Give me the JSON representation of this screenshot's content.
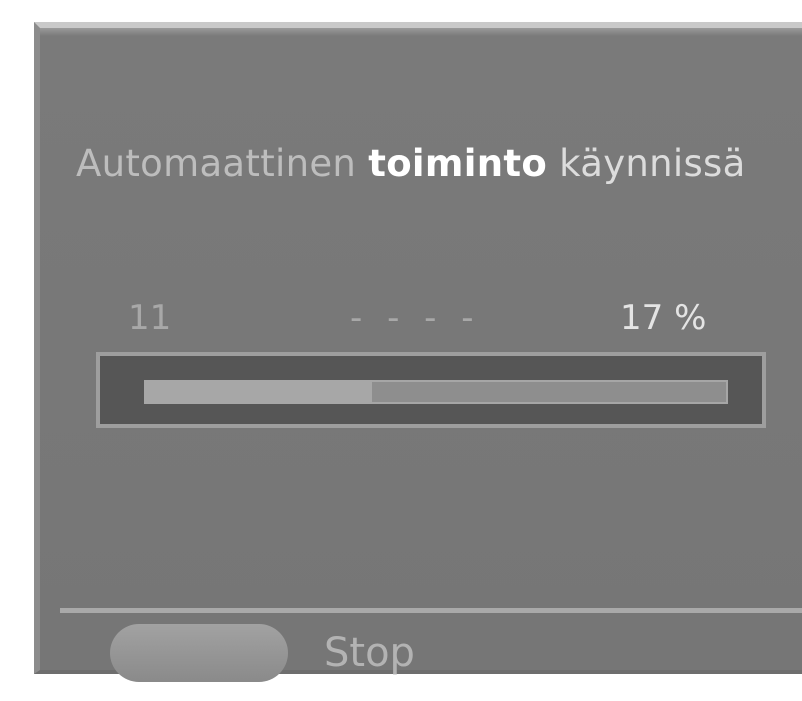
{
  "dialog": {
    "title_part1": "Automaattinen ",
    "title_part2": "toiminto",
    "title_part3": " käynnissä"
  },
  "progress": {
    "channel": "11",
    "station": "- - - -",
    "percent_label": "17 %",
    "percent": 17
  },
  "footer": {
    "stop_label": "Stop",
    "stop_button_color": "#999999"
  },
  "colors": {
    "panel_bg": "#787878",
    "highlight_text": "#ffffff",
    "dim_text": "#bdbdbd"
  }
}
